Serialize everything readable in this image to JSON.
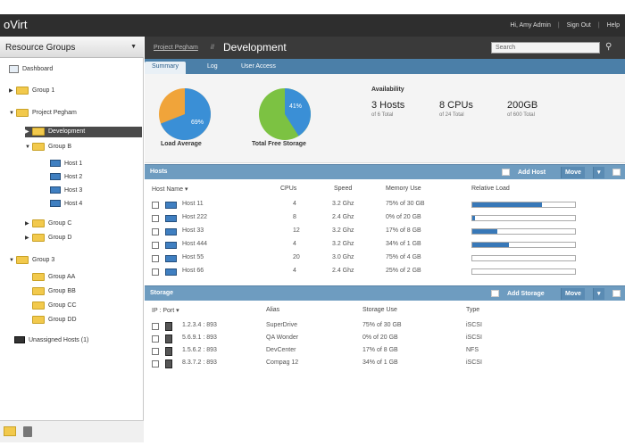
{
  "app": {
    "logo": "oVirt"
  },
  "toplinks": {
    "user": "Hi, Amy Admin",
    "signout": "Sign Out",
    "help": "Help"
  },
  "sidebar": {
    "title": "Resource Groups",
    "items": [
      {
        "label": "Dashboard",
        "type": "dashboard"
      },
      {
        "label": "Group 1",
        "type": "folder"
      },
      {
        "label": "Project Pegham",
        "type": "folder"
      },
      {
        "label": "Development",
        "type": "folder",
        "selected": true
      },
      {
        "label": "Group B",
        "type": "folder"
      },
      {
        "label": "Host 1",
        "type": "host"
      },
      {
        "label": "Host 2",
        "type": "host"
      },
      {
        "label": "Host 3",
        "type": "host"
      },
      {
        "label": "Host 4",
        "type": "host"
      },
      {
        "label": "Group C",
        "type": "folder"
      },
      {
        "label": "Group D",
        "type": "folder"
      },
      {
        "label": "Group 3",
        "type": "folder"
      },
      {
        "label": "Group AA",
        "type": "folder"
      },
      {
        "label": "Group BB",
        "type": "folder"
      },
      {
        "label": "Group CC",
        "type": "folder"
      },
      {
        "label": "Group DD",
        "type": "folder"
      },
      {
        "label": "Unassigned Hosts  (1)",
        "type": "unassigned"
      }
    ]
  },
  "breadcrumb": {
    "parent": "Project Pegham",
    "separator": "//",
    "current": "Development"
  },
  "search": {
    "placeholder": "Search"
  },
  "tabs": [
    {
      "label": "Summary",
      "active": true
    },
    {
      "label": "Log",
      "active": false
    },
    {
      "label": "User Access",
      "active": false
    }
  ],
  "summary": {
    "load_average": {
      "label": "Load Average",
      "percent": 69,
      "pct_text": "69%",
      "color_main": "#3a8fd6",
      "color_rest": "#f0a43a"
    },
    "free_storage": {
      "label": "Total Free Storage",
      "percent": 41,
      "pct_text": "41%",
      "color_main": "#3a8fd6",
      "color_rest": "#7cc242"
    },
    "availability": {
      "title": "Availability",
      "stats": [
        {
          "value": "3 Hosts",
          "sub": "of 6 Total"
        },
        {
          "value": "8 CPUs",
          "sub": "of 24 Total"
        },
        {
          "value": "200GB",
          "sub": "of 600 Total"
        }
      ]
    }
  },
  "hosts": {
    "title": "Hosts",
    "add_label": "Add Host",
    "move_label": "Move",
    "columns": [
      "Host Name",
      "CPUs",
      "Speed",
      "Memory Use",
      "Relative Load"
    ],
    "rows": [
      {
        "name": "Host 11",
        "cpus": "4",
        "speed": "3.2 Ghz",
        "memory": "75% of 30 GB",
        "load": 0.68
      },
      {
        "name": "Host 222",
        "cpus": "8",
        "speed": "2.4 Ghz",
        "memory": "0% of 20 GB",
        "load": 0.03
      },
      {
        "name": "Host 33",
        "cpus": "12",
        "speed": "3.2 Ghz",
        "memory": "17% of 8 GB",
        "load": 0.24
      },
      {
        "name": "Host 444",
        "cpus": "4",
        "speed": "3.2 Ghz",
        "memory": "34% of 1 GB",
        "load": 0.36
      },
      {
        "name": "Host 55",
        "cpus": "20",
        "speed": "3.0 Ghz",
        "memory": "75% of 4 GB",
        "load": 0.0
      },
      {
        "name": "Host 66",
        "cpus": "4",
        "speed": "2.4 Ghz",
        "memory": "25% of 2 GB",
        "load": 0.0
      }
    ]
  },
  "storage": {
    "title": "Storage",
    "add_label": "Add Storage",
    "move_label": "Move",
    "columns": [
      "IP : Port",
      "Alias",
      "Storage Use",
      "Type"
    ],
    "rows": [
      {
        "ip": "1.2.3.4 : 893",
        "alias": "SuperDrive",
        "use": "75% of 30 GB",
        "type": "iSCSI"
      },
      {
        "ip": "5.6.9.1 : 893",
        "alias": "QA Wonder",
        "use": "0% of 20 GB",
        "type": "iSCSI"
      },
      {
        "ip": "1.5.6.2 : 893",
        "alias": "DevCenter",
        "use": "17% of 8 GB",
        "type": "NFS"
      },
      {
        "ip": "8.3.7.2 : 893",
        "alias": "Compag 12",
        "use": "34% of 1 GB",
        "type": "iSCSI"
      }
    ]
  }
}
